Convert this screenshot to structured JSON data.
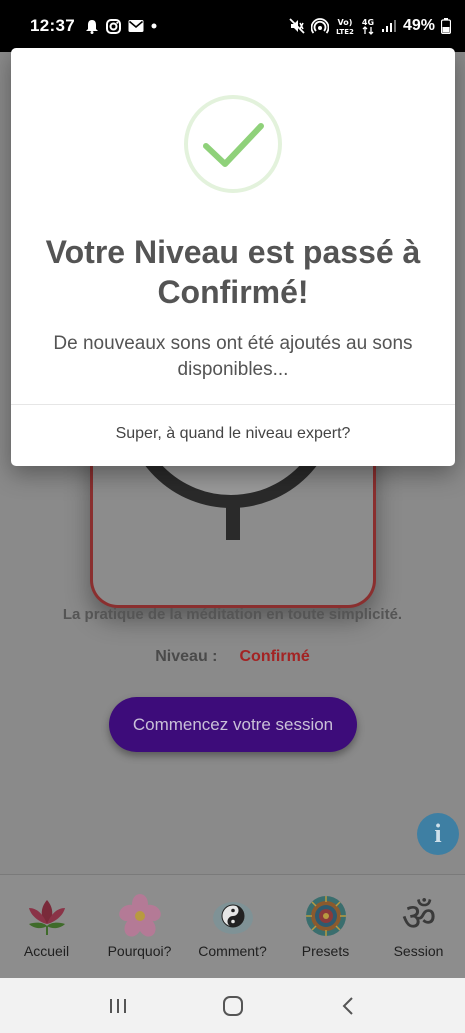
{
  "status_bar": {
    "time": "12:37",
    "battery": "49%",
    "network_labels": [
      "Vo) LTE2",
      "4G"
    ]
  },
  "dialog": {
    "title": "Votre Niveau est passé à Confirmé!",
    "message": "De nouveaux sons ont été ajoutés au sons disponibles...",
    "action": "Super, à quand le niveau expert?",
    "check_color": "#8fd17a"
  },
  "home": {
    "tagline": "La pratique de la méditation en toute simplicité.",
    "level_label": "Niveau :",
    "level_value": "Confirmé",
    "start_button": "Commencez votre session",
    "info_icon": "info-icon"
  },
  "bottom_nav": {
    "items": [
      {
        "label": "Accueil",
        "icon": "lotus-icon"
      },
      {
        "label": "Pourquoi?",
        "icon": "flower-icon"
      },
      {
        "label": "Comment?",
        "icon": "yin-yang-icon"
      },
      {
        "label": "Presets",
        "icon": "mandala-icon"
      },
      {
        "label": "Session",
        "icon": "om-icon"
      }
    ]
  },
  "colors": {
    "accent_purple": "#5b15b8",
    "level_red": "#d32f2f",
    "check_green": "#8fd17a"
  }
}
